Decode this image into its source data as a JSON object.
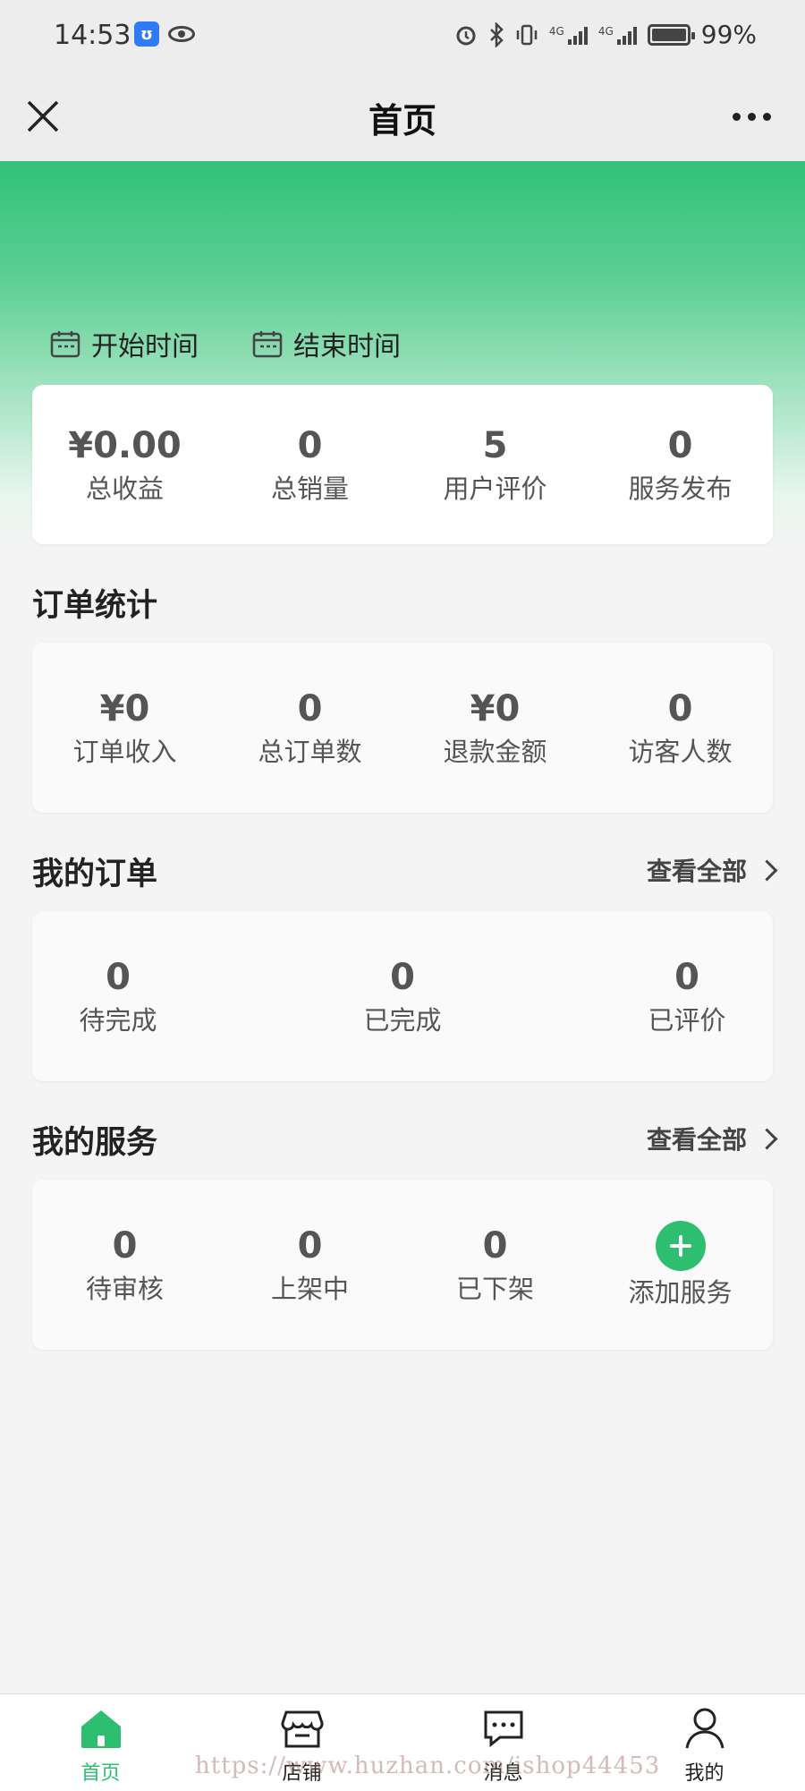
{
  "status_bar": {
    "time": "14:53",
    "battery": "99%",
    "net1": "4G",
    "net2": "4G"
  },
  "nav": {
    "title": "首页"
  },
  "dates": {
    "start_label": "开始时间",
    "end_label": "结束时间"
  },
  "summary": [
    {
      "value": "¥0.00",
      "label": "总收益"
    },
    {
      "value": "0",
      "label": "总销量"
    },
    {
      "value": "5",
      "label": "用户评价"
    },
    {
      "value": "0",
      "label": "服务发布"
    }
  ],
  "order_stats": {
    "title": "订单统计",
    "items": [
      {
        "value": "¥0",
        "label": "订单收入"
      },
      {
        "value": "0",
        "label": "总订单数"
      },
      {
        "value": "¥0",
        "label": "退款金额"
      },
      {
        "value": "0",
        "label": "访客人数"
      }
    ]
  },
  "my_orders": {
    "title": "我的订单",
    "view_all": "查看全部",
    "items": [
      {
        "value": "0",
        "label": "待完成"
      },
      {
        "value": "0",
        "label": "已完成"
      },
      {
        "value": "0",
        "label": "已评价"
      }
    ]
  },
  "my_services": {
    "title": "我的服务",
    "view_all": "查看全部",
    "items": [
      {
        "value": "0",
        "label": "待审核"
      },
      {
        "value": "0",
        "label": "上架中"
      },
      {
        "value": "0",
        "label": "已下架"
      }
    ],
    "add_label": "添加服务"
  },
  "tabs": [
    {
      "label": "首页",
      "icon": "home-icon",
      "active": true
    },
    {
      "label": "店铺",
      "icon": "store-icon",
      "active": false
    },
    {
      "label": "消息",
      "icon": "message-icon",
      "active": false
    },
    {
      "label": "我的",
      "icon": "user-icon",
      "active": false
    }
  ],
  "colors": {
    "accent": "#2dbf6f",
    "hero_top": "#30c278"
  },
  "watermark": "https://www.huzhan.com/ishop44453"
}
